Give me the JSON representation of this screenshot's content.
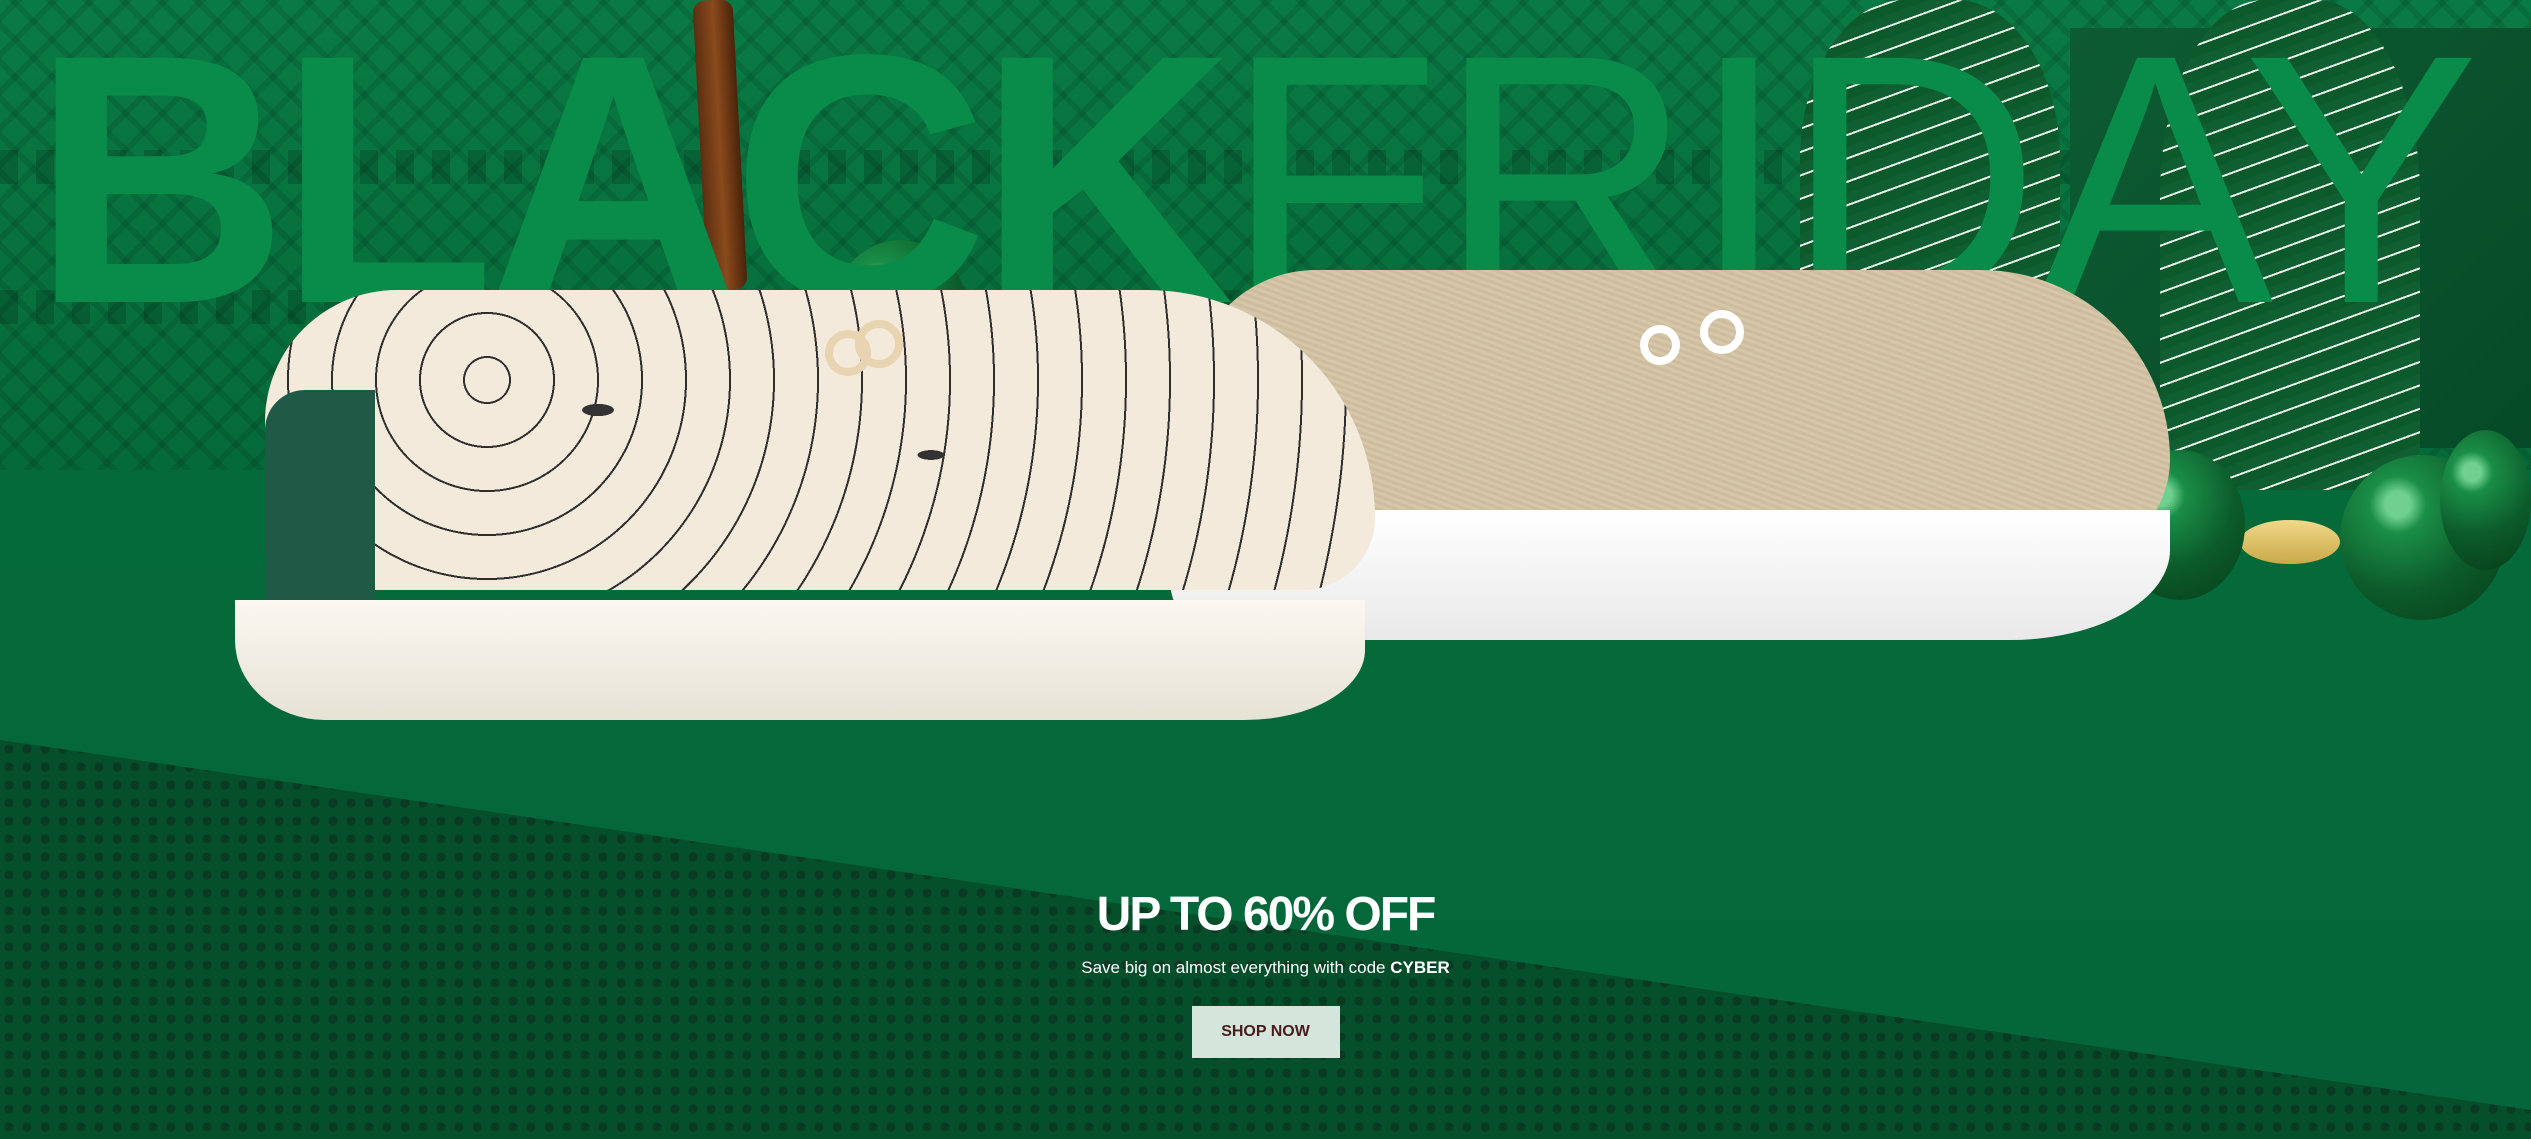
{
  "hero": {
    "headline_word_1": "BLACK",
    "headline_word_2": "FRIDAY",
    "promo_title": "UP TO 60% OFF",
    "promo_sub_text": "Save big on almost everything with code ",
    "promo_code": "CYBER",
    "cta_label": "SHOP NOW"
  },
  "colors": {
    "background": "#04673a",
    "headline": "#098b4a",
    "cta_background": "#d4e5dc",
    "cta_text": "#4a1b1b"
  }
}
